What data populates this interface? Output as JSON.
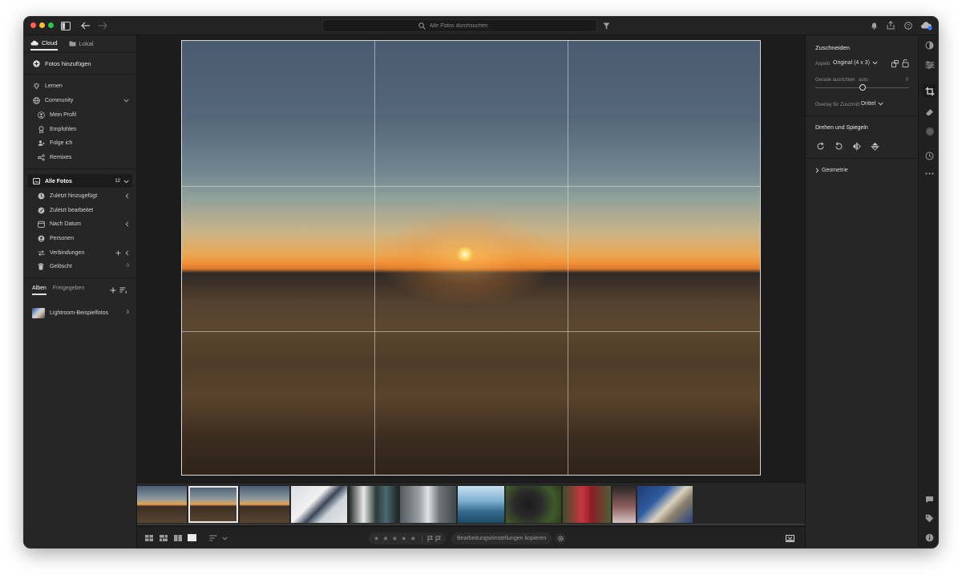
{
  "search": {
    "placeholder": "Alle Fotos durchsuchen"
  },
  "left": {
    "tab_cloud": "Cloud",
    "tab_lokal": "Lokal",
    "add_photos": "Fotos hinzufügen",
    "lernen": "Lernen",
    "community": "Community",
    "community_items": [
      "Mein Profil",
      "Empfohlen",
      "Folge ich",
      "Remixes"
    ],
    "alle_fotos": "Alle Fotos",
    "alle_fotos_count": "12",
    "library_items": [
      "Zuletzt hinzugefügt",
      "Zuletzt bearbeitet",
      "Nach Datum",
      "Personen",
      "Verbindungen",
      "Gelöscht"
    ],
    "geloescht_count": "0",
    "albums_tab": "Alben",
    "shared_tab": "Freigegeben",
    "album_name": "Lightroom-Beispielfotos",
    "album_count": "9"
  },
  "right": {
    "crop_title": "Zuschneiden",
    "aspect_label": "Aspekt",
    "aspect_value": "Original (4 x 3)",
    "straighten_label": "Gerade ausrichten",
    "straighten_auto": "auto",
    "straighten_value": "0",
    "straighten_level": 0.5,
    "overlay_label": "Overlay für Zuschnitt",
    "overlay_value": "Drittel",
    "rotate_title": "Drehen und Spiegeln",
    "geometry": "Geometrie"
  },
  "bottom": {
    "copy_settings": "Bearbeitungseinstellungen kopieren",
    "stars": "★ ★ ★ ★ ★"
  }
}
